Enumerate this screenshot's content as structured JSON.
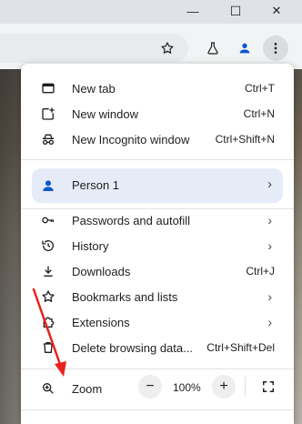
{
  "window": {
    "minimize_glyph": "—",
    "restore_glyph": "☐",
    "close_glyph": "✕"
  },
  "toolbar": {
    "bookmark_icon": "star-outline-icon",
    "labs_icon": "flask-icon",
    "profile_icon": "person-icon",
    "menu_icon": "vertical-dots-icon"
  },
  "menu": {
    "items_top": [
      {
        "label": "New tab",
        "shortcut": "Ctrl+T",
        "icon": "new-tab-icon"
      },
      {
        "label": "New window",
        "shortcut": "Ctrl+N",
        "icon": "new-window-icon"
      },
      {
        "label": "New Incognito window",
        "shortcut": "Ctrl+Shift+N",
        "icon": "incognito-icon"
      }
    ],
    "profile": {
      "label": "Person 1",
      "icon": "person-icon"
    },
    "items_mid": [
      {
        "label": "Passwords and autofill",
        "icon": "key-icon",
        "submenu": true
      },
      {
        "label": "History",
        "icon": "history-icon",
        "submenu": true
      },
      {
        "label": "Downloads",
        "shortcut": "Ctrl+J",
        "icon": "download-icon"
      },
      {
        "label": "Bookmarks and lists",
        "icon": "star-icon",
        "submenu": true
      },
      {
        "label": "Extensions",
        "icon": "puzzle-icon",
        "submenu": true
      },
      {
        "label": "Delete browsing data...",
        "shortcut": "Ctrl+Shift+Del",
        "icon": "trash-icon"
      }
    ],
    "zoom": {
      "label": "Zoom",
      "value": "100%",
      "minus": "−",
      "plus": "+"
    }
  },
  "colors": {
    "accent": "#0b57d0",
    "profile_bg": "#e5ecf8",
    "annotation_arrow": "#e8231b"
  }
}
